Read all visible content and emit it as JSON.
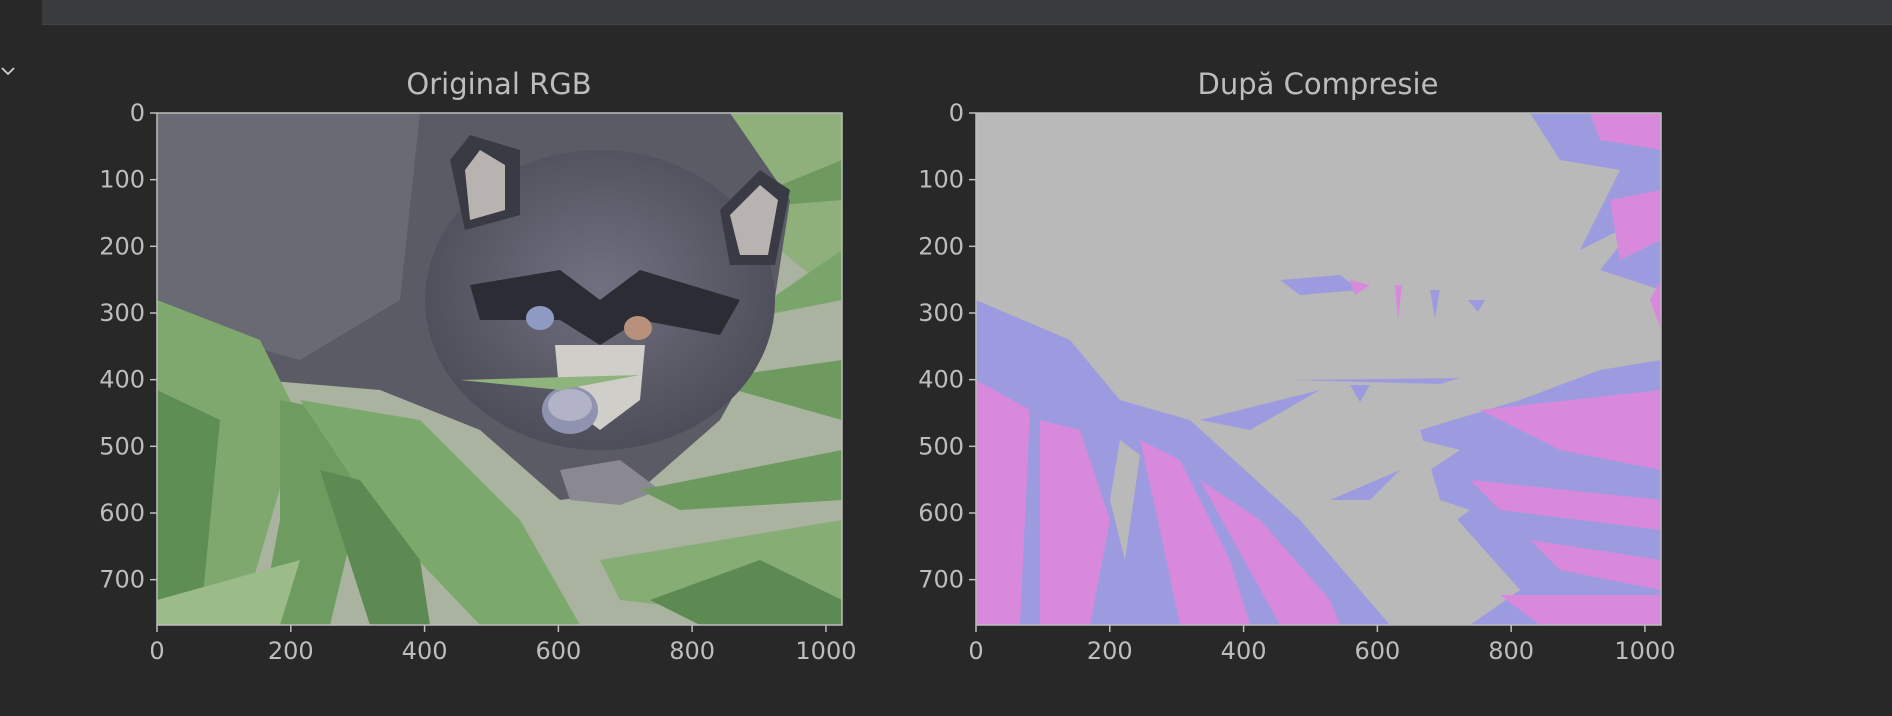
{
  "notebook": {
    "output_collapsed": false
  },
  "figure": {
    "background": "#282828",
    "text_color": "#bdbdbd",
    "axis_color": "#bdbdbd"
  },
  "chart_data": [
    {
      "type": "image",
      "title": "Original RGB",
      "xlim": [
        0,
        1024
      ],
      "ylim": [
        768,
        0
      ],
      "xticks": [
        0,
        200,
        400,
        600,
        800,
        1000
      ],
      "yticks": [
        0,
        100,
        200,
        300,
        400,
        500,
        600,
        700
      ],
      "content": "raccoon-photo"
    },
    {
      "type": "image",
      "title": "După Compresie",
      "xlim": [
        0,
        1024
      ],
      "ylim": [
        768,
        0
      ],
      "xticks": [
        0,
        200,
        400,
        600,
        800,
        1000
      ],
      "yticks": [
        0,
        100,
        200,
        300,
        400,
        500,
        600,
        700
      ],
      "content": "quantized-3-colors",
      "palette": [
        "#b9b9b9",
        "#9d9be0",
        "#d889dc"
      ]
    }
  ]
}
